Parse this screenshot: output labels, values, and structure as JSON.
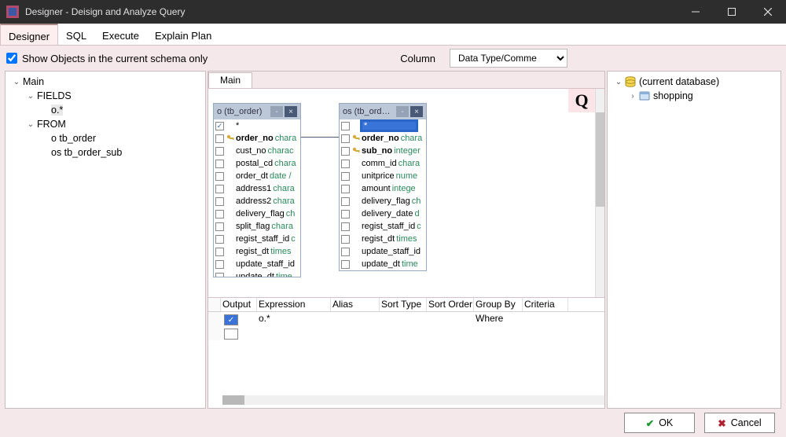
{
  "window": {
    "title": "Designer - Deisign and Analyze Query"
  },
  "tabs": {
    "designer": "Designer",
    "sql": "SQL",
    "execute": "Execute",
    "explain": "Explain Plan"
  },
  "toolbar": {
    "show_objects_label": "Show Objects in the current schema only",
    "show_objects_checked": true,
    "column_label": "Column",
    "column_select": "Data Type/Comment"
  },
  "left_tree": {
    "main": "Main",
    "fields": "FIELDS",
    "field0": "o.*",
    "from": "FROM",
    "from0": "o tb_order",
    "from1": "os tb_order_sub"
  },
  "center_tab": "Main",
  "q_corner": "Q",
  "tables": {
    "o": {
      "title": "o (tb_order)",
      "star": "*",
      "cols": [
        {
          "name": "order_no",
          "type": "chara",
          "pk": true,
          "bold": true
        },
        {
          "name": "cust_no",
          "type": "charac"
        },
        {
          "name": "postal_cd",
          "type": "chara"
        },
        {
          "name": "order_dt",
          "type": "date /"
        },
        {
          "name": "address1",
          "type": "chara"
        },
        {
          "name": "address2",
          "type": "chara"
        },
        {
          "name": "delivery_flag",
          "type": "ch"
        },
        {
          "name": "split_flag",
          "type": "chara"
        },
        {
          "name": "regist_staff_id",
          "type": "c"
        },
        {
          "name": "regist_dt",
          "type": "times"
        },
        {
          "name": "update_staff_id",
          "type": ""
        },
        {
          "name": "update_dt",
          "type": "time"
        }
      ]
    },
    "os": {
      "title": "os (tb_order_s...",
      "star": "*",
      "cols": [
        {
          "name": "order_no",
          "type": "chara",
          "pk": true,
          "bold": true
        },
        {
          "name": "sub_no",
          "type": "integer",
          "pk": true,
          "bold": true
        },
        {
          "name": "comm_id",
          "type": "chara"
        },
        {
          "name": "unitprice",
          "type": "nume"
        },
        {
          "name": "amount",
          "type": "intege"
        },
        {
          "name": "delivery_flag",
          "type": "ch"
        },
        {
          "name": "delivery_date",
          "type": "d"
        },
        {
          "name": "regist_staff_id",
          "type": "c"
        },
        {
          "name": "regist_dt",
          "type": "times"
        },
        {
          "name": "update_staff_id",
          "type": ""
        },
        {
          "name": "update_dt",
          "type": "time"
        }
      ]
    }
  },
  "grid": {
    "headers": {
      "output": "Output",
      "expr": "Expression",
      "alias": "Alias",
      "sortt": "Sort Type",
      "sorto": "Sort Order",
      "group": "Group By",
      "crit": "Criteria"
    },
    "where": "Where",
    "row0_expr": "o.*"
  },
  "right_tree": {
    "db": "(current database)",
    "schema": "shopping"
  },
  "footer": {
    "ok": "OK",
    "cancel": "Cancel"
  }
}
